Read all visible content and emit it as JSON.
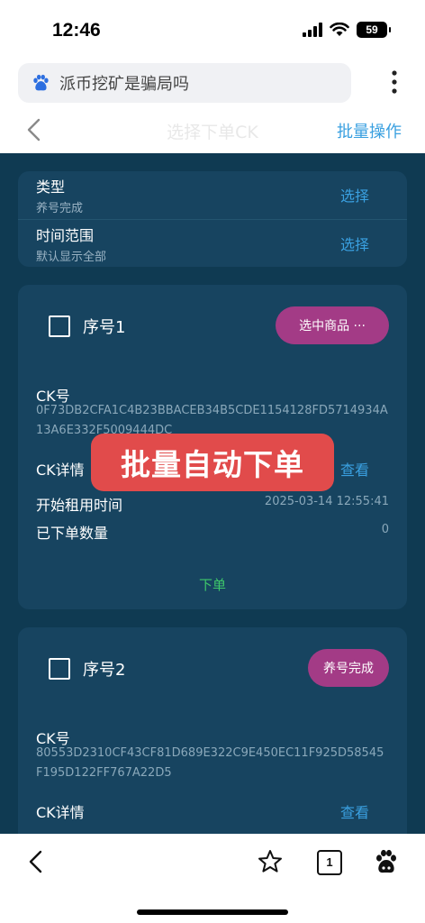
{
  "status": {
    "time": "12:46",
    "battery": "59"
  },
  "browser": {
    "search_text": "派币挖矿是骗局吗"
  },
  "nav": {
    "title": "选择下单CK",
    "action": "批量操作"
  },
  "filters": [
    {
      "label": "类型",
      "sub": "养号完成",
      "button": "选择"
    },
    {
      "label": "时间范围",
      "sub": "默认显示全部",
      "button": "选择"
    }
  ],
  "orders": [
    {
      "seq": "序号1",
      "pill": "选中商品 ···",
      "ck_label": "CK号",
      "ck_value": "0F73DB2CFA1C4B23BBACEB34B5CDE1154128FD5714934A13A6E332F5009444DC",
      "detail_label": "CK详情",
      "detail_action": "查看",
      "rent_label": "开始租用时间",
      "rent_value": "2025-03-14 12:55:41",
      "count_label": "已下单数量",
      "count_value": "0",
      "order_button": "下单"
    },
    {
      "seq": "序号2",
      "pill": "养号完成",
      "ck_label": "CK号",
      "ck_value": "80553D2310CF43CF81D689E322C9E450EC11F925D58545F195D122FF767A22D5",
      "detail_label": "CK详情",
      "detail_action": "查看"
    }
  ],
  "overlay": {
    "text": "批量自动下单"
  },
  "bottom": {
    "tab_count": "1"
  },
  "colors": {
    "background": "#0f3a52",
    "card": "#174460",
    "accent": "#3aa0e0",
    "pill": "#a33b86",
    "order": "#3ec76a",
    "banner": "#e14b4b"
  }
}
